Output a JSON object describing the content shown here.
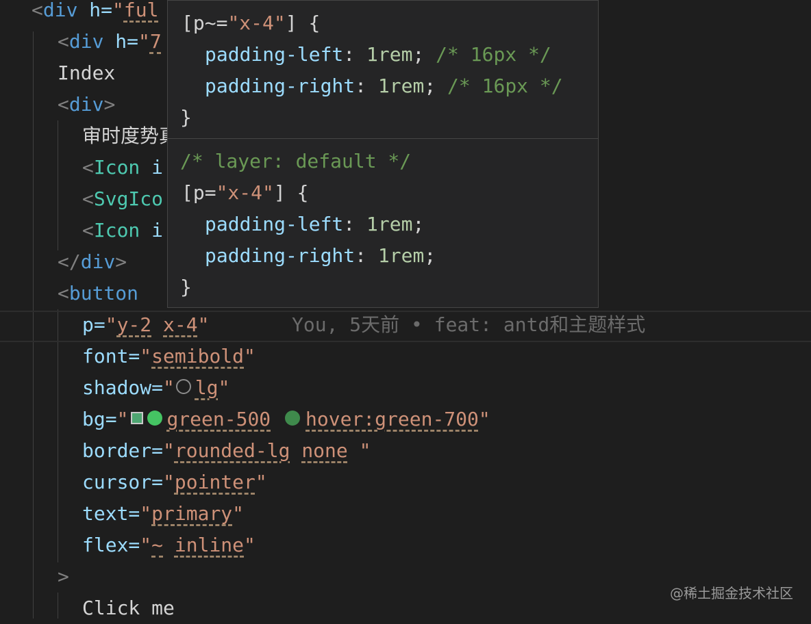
{
  "code": {
    "l1": {
      "open": "<",
      "tag": "div",
      "attr": " h=",
      "q": "\"",
      "val": "ful"
    },
    "l2": {
      "open": "<",
      "tag": "div",
      "attr": " h=",
      "q": "\"",
      "val": "7"
    },
    "l3": {
      "text": "Index"
    },
    "l4": {
      "open": "<",
      "tag": "div",
      "close": ">"
    },
    "l5": {
      "text": "审时度势真"
    },
    "l6": {
      "open": "<",
      "tag": "Icon",
      "rest": " i"
    },
    "l7": {
      "open": "<",
      "tag": "SvgIco"
    },
    "l8": {
      "open": "<",
      "tag": "Icon",
      "rest": " i"
    },
    "l9": {
      "open": "</",
      "tag": "div",
      "close": ">"
    },
    "l10": {
      "open": "<",
      "tag": "button"
    },
    "l11": {
      "attr": "p=",
      "q1": "\"",
      "v1": "y-2",
      "sp": " ",
      "v2": "x-4",
      "q2": "\"",
      "blame": "You, 5天前 • feat: antd和主题样式"
    },
    "l12": {
      "attr": "font=",
      "q1": "\"",
      "v1": "semibold",
      "q2": "\""
    },
    "l13": {
      "attr": "shadow=",
      "q1": "\"",
      "v1": "lg",
      "q2": "\""
    },
    "l14": {
      "attr": "bg=",
      "q1": "\"",
      "v1": "green-500",
      "v2": "hover:green-700",
      "q2": "\""
    },
    "l15": {
      "attr": "border=",
      "q1": "\"",
      "v1": "rounded-lg",
      "v2": "none",
      "q2": " \""
    },
    "l16": {
      "attr": "cursor=",
      "q1": "\"",
      "v1": "pointer",
      "q2": "\""
    },
    "l17": {
      "attr": "text=",
      "q1": "\"",
      "v1": "primary",
      "q2": "\""
    },
    "l18": {
      "attr": "flex=",
      "q1": "\"",
      "v1": "~",
      "v2": "inline",
      "q2": "\""
    },
    "l19": {
      "close": ">"
    },
    "l20": {
      "text": "Click me"
    }
  },
  "hover": {
    "block1": {
      "selector_open": "[p~=",
      "selector_val": "\"x-4\"",
      "selector_close": "] {",
      "p1_name": "padding-left",
      "p1_colon": ": ",
      "p1_val": "1rem",
      "p1_semi": ";",
      "p1_comment": "/* 16px */",
      "p2_name": "padding-right",
      "p2_colon": ": ",
      "p2_val": "1rem",
      "p2_semi": ";",
      "p2_comment": "/* 16px */",
      "end": "}"
    },
    "block2": {
      "layer_comment": "/* layer: default */",
      "selector_open": "[p=",
      "selector_val": "\"x-4\"",
      "selector_close": "] {",
      "p1_name": "padding-left",
      "p1_colon": ": ",
      "p1_val": "1rem",
      "p1_semi": ";",
      "p2_name": "padding-right",
      "p2_colon": ": ",
      "p2_val": "1rem",
      "p2_semi": ";",
      "end": "}"
    }
  },
  "colors": {
    "bg": "#1e1e1e",
    "tag": "#569cd6",
    "component": "#4ec9b0",
    "attribute": "#9cdcfe",
    "string": "#ce9178",
    "comment": "#6a9955",
    "swatch_green_500": "#45c463",
    "swatch_green_700": "#3f8a4c"
  },
  "icons": [
    "color-swatch-square-icon",
    "shadow-circle-icon",
    "green-500-circle-icon",
    "green-700-circle-icon"
  ],
  "watermark": "@稀土掘金技术社区"
}
